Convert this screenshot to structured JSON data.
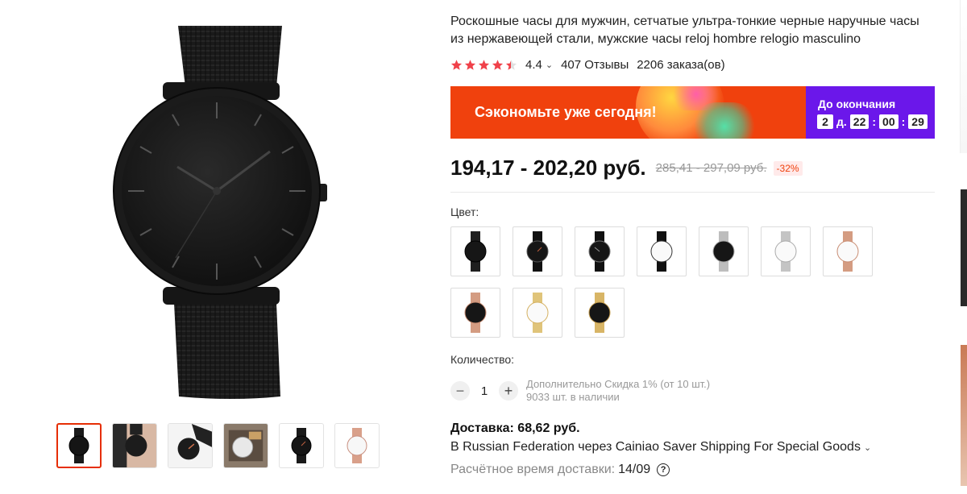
{
  "product": {
    "title": "Роскошные часы для мужчин, сетчатые ультра-тонкие черные наручные часы из нержавеющей стали, мужские часы reloj hombre relogio masculino"
  },
  "rating": {
    "score": "4.4",
    "stars": 4.4,
    "reviews": "407 Отзывы",
    "orders": "2206 заказа(ов)"
  },
  "promo": {
    "text": "Сэкономьте уже сегодня!",
    "timer_label": "До окончания",
    "days": "2",
    "days_unit": "д.",
    "hours": "22",
    "minutes": "00",
    "seconds": "29"
  },
  "price": {
    "current": "194,17 - 202,20 руб.",
    "old": "285,41 - 297,09 руб.",
    "discount": "-32%"
  },
  "color": {
    "label": "Цвет:",
    "options": [
      {
        "icon": "watch-black-mesh"
      },
      {
        "icon": "watch-black-leather"
      },
      {
        "icon": "watch-black-leather-2"
      },
      {
        "icon": "watch-white-black-strap"
      },
      {
        "icon": "watch-black-silver-mesh"
      },
      {
        "icon": "watch-white-silver-mesh"
      },
      {
        "icon": "watch-white-rosegold-mesh"
      },
      {
        "icon": "watch-black-rosegold-mesh"
      },
      {
        "icon": "watch-white-gold-mesh"
      },
      {
        "icon": "watch-black-gold-mesh"
      }
    ]
  },
  "quantity": {
    "label": "Количество:",
    "value": "1",
    "minus": "−",
    "plus": "+",
    "discount_note": "Дополнительно Скидка 1% (от 10 шт.)",
    "stock": "9033 шт. в наличии"
  },
  "shipping": {
    "price": "Доставка: 68,62 руб.",
    "via": "В Russian Federation через Cainiao Saver Shipping For Special Goods",
    "eta_label": "Расчётное время доставки:",
    "eta_date": "14/09"
  },
  "colors": {
    "accent": "#f0410d",
    "timer_bg": "#6b17ea",
    "star": "#f0414a"
  }
}
